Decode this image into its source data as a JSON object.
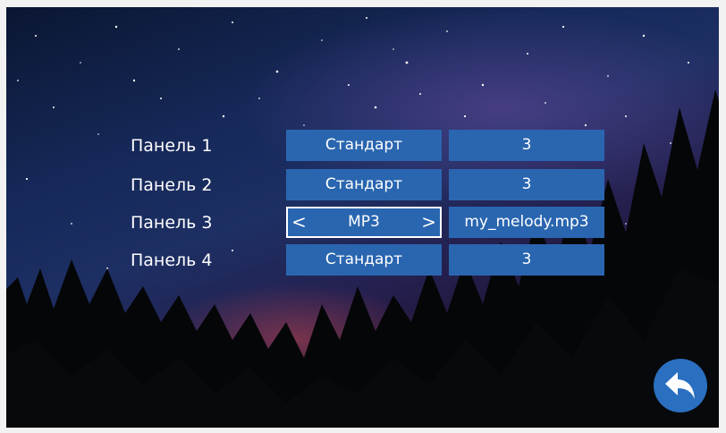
{
  "panels": [
    {
      "label": "Панель 1",
      "type": "Стандарт",
      "value": "3"
    },
    {
      "label": "Панель 2",
      "type": "Стандарт",
      "value": "3"
    },
    {
      "label": "Панель 3",
      "type": "MP3",
      "value": "my_melody.mp3"
    },
    {
      "label": "Панель 4",
      "type": "Стандарт",
      "value": "3"
    }
  ],
  "selector": {
    "left_arrow": "<",
    "right_arrow": ">"
  },
  "icons": {
    "back": "back-arrow-icon"
  },
  "colors": {
    "cell": "#2a66b0",
    "selected_border": "#ffffff",
    "back_button": "#2a6fc0"
  }
}
